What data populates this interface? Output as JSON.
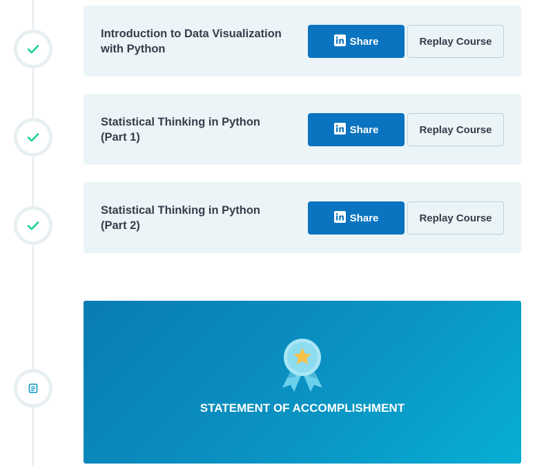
{
  "courses": [
    {
      "title": "Introduction to Data Visualization with Python",
      "share_label": "Share",
      "replay_label": "Replay Course"
    },
    {
      "title": "Statistical Thinking in Python (Part 1)",
      "share_label": "Share",
      "replay_label": "Replay Course"
    },
    {
      "title": "Statistical Thinking in Python (Part 2)",
      "share_label": "Share",
      "replay_label": "Replay Course"
    }
  ],
  "statement": {
    "label": "STATEMENT OF ACCOMPLISHMENT",
    "icon": "award-ribbon-icon"
  },
  "icons": {
    "completed": "check-icon",
    "statement_node": "document-icon",
    "share": "linkedin-icon"
  },
  "colors": {
    "check": "#2ad49a",
    "card_background": "#ebf4f7",
    "share_button": "#0a74c0",
    "statement_gradient_start": "#0a7cb1",
    "statement_gradient_end": "#08aed4",
    "title_text": "#3a3a4b"
  }
}
